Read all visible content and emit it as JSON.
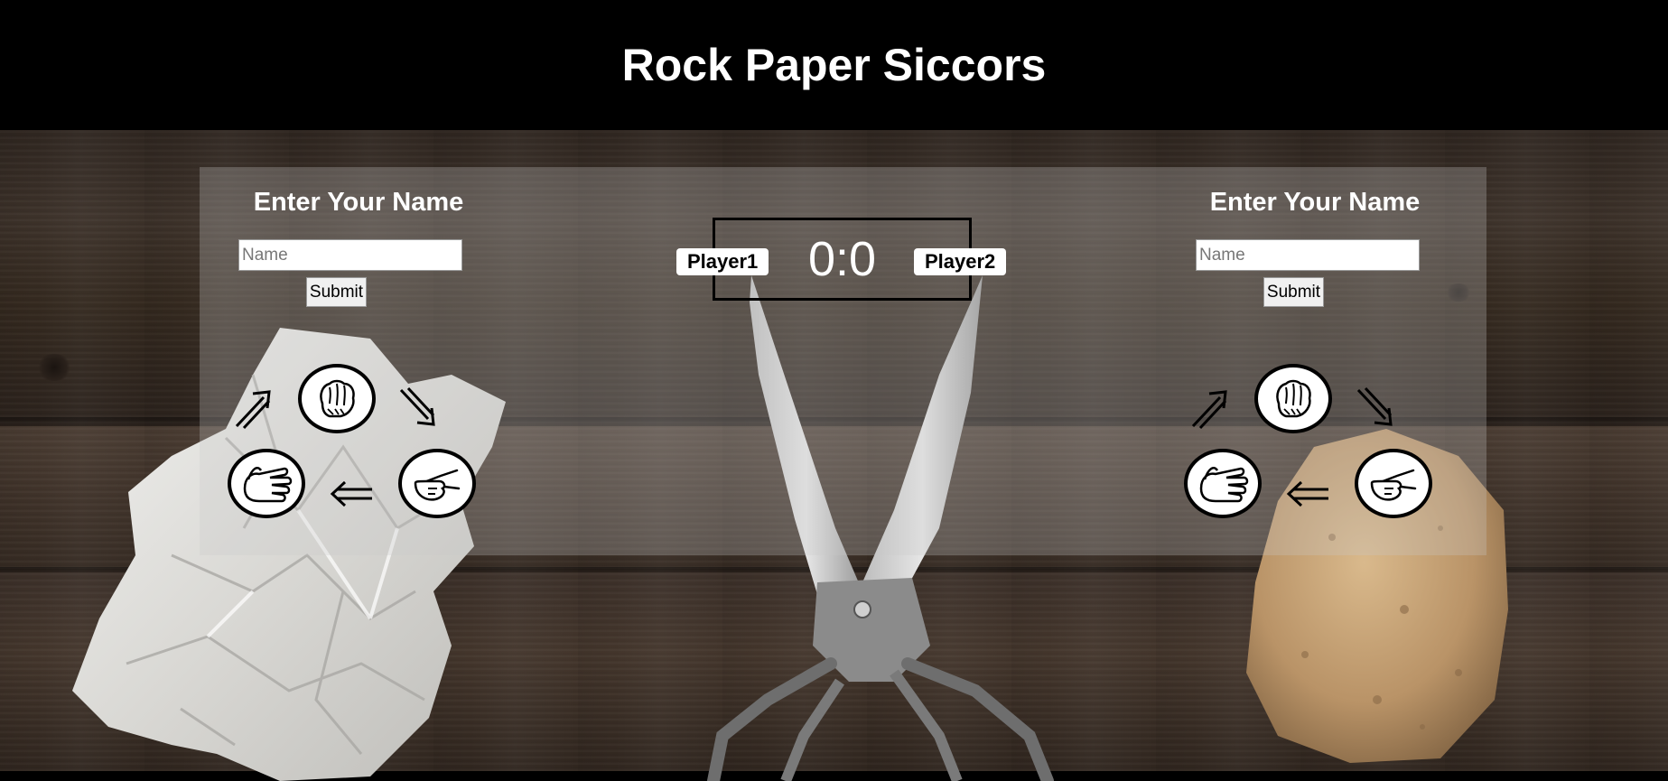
{
  "title": "Rock Paper Siccors",
  "player_left": {
    "heading": "Enter Your Name",
    "input_placeholder": "Name",
    "input_value": "",
    "submit_label": "Submit",
    "moves": [
      "rock-hand-icon",
      "scissors-hand-icon",
      "paper-hand-icon"
    ]
  },
  "player_right": {
    "heading": "Enter Your Name",
    "input_placeholder": "Name",
    "input_value": "",
    "submit_label": "Submit",
    "moves": [
      "rock-hand-icon",
      "scissors-hand-icon",
      "paper-hand-icon"
    ]
  },
  "scoreboard": {
    "player1_label": "Player1",
    "player2_label": "Player2",
    "score": "0:0"
  },
  "colors": {
    "header_bg": "#000000",
    "title_text": "#ffffff",
    "panel": "rgba(200,200,200,0.28)",
    "wood": "#3a2f28"
  },
  "icons": {
    "arrow_up_right": "double-arrow-up-right-icon",
    "arrow_down_right": "double-arrow-down-right-icon",
    "arrow_left": "double-arrow-left-icon"
  }
}
